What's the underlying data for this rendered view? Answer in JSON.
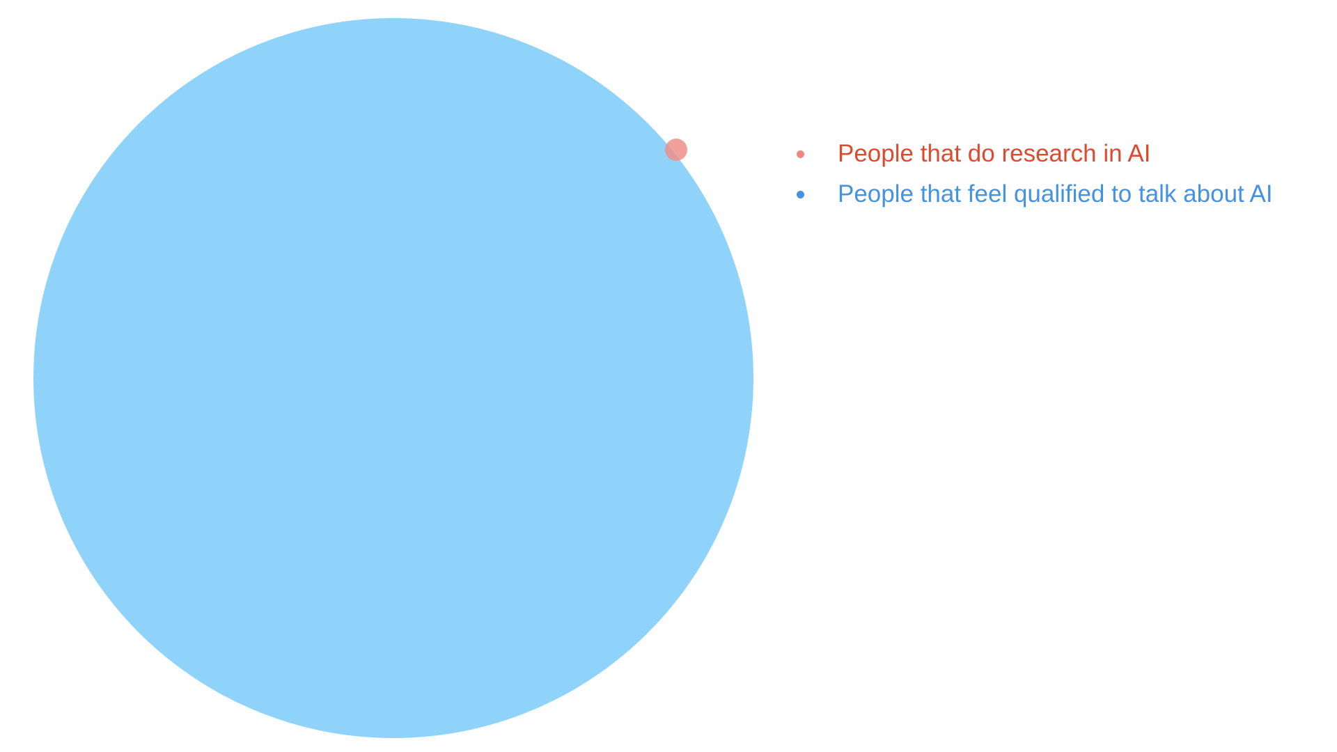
{
  "diagram": {
    "type": "euler",
    "sets": [
      {
        "key": "researchers",
        "label": "People that do research in AI",
        "fill_color": "#ee8f8a",
        "text_color": "#dd4a2e",
        "bullet_color": "#f08880"
      },
      {
        "key": "qualified_talkers",
        "label": "People that feel qualified to talk about AI",
        "fill_color": "#90d3fa",
        "text_color": "#4492e0",
        "bullet_color": "#4492e0"
      }
    ]
  }
}
